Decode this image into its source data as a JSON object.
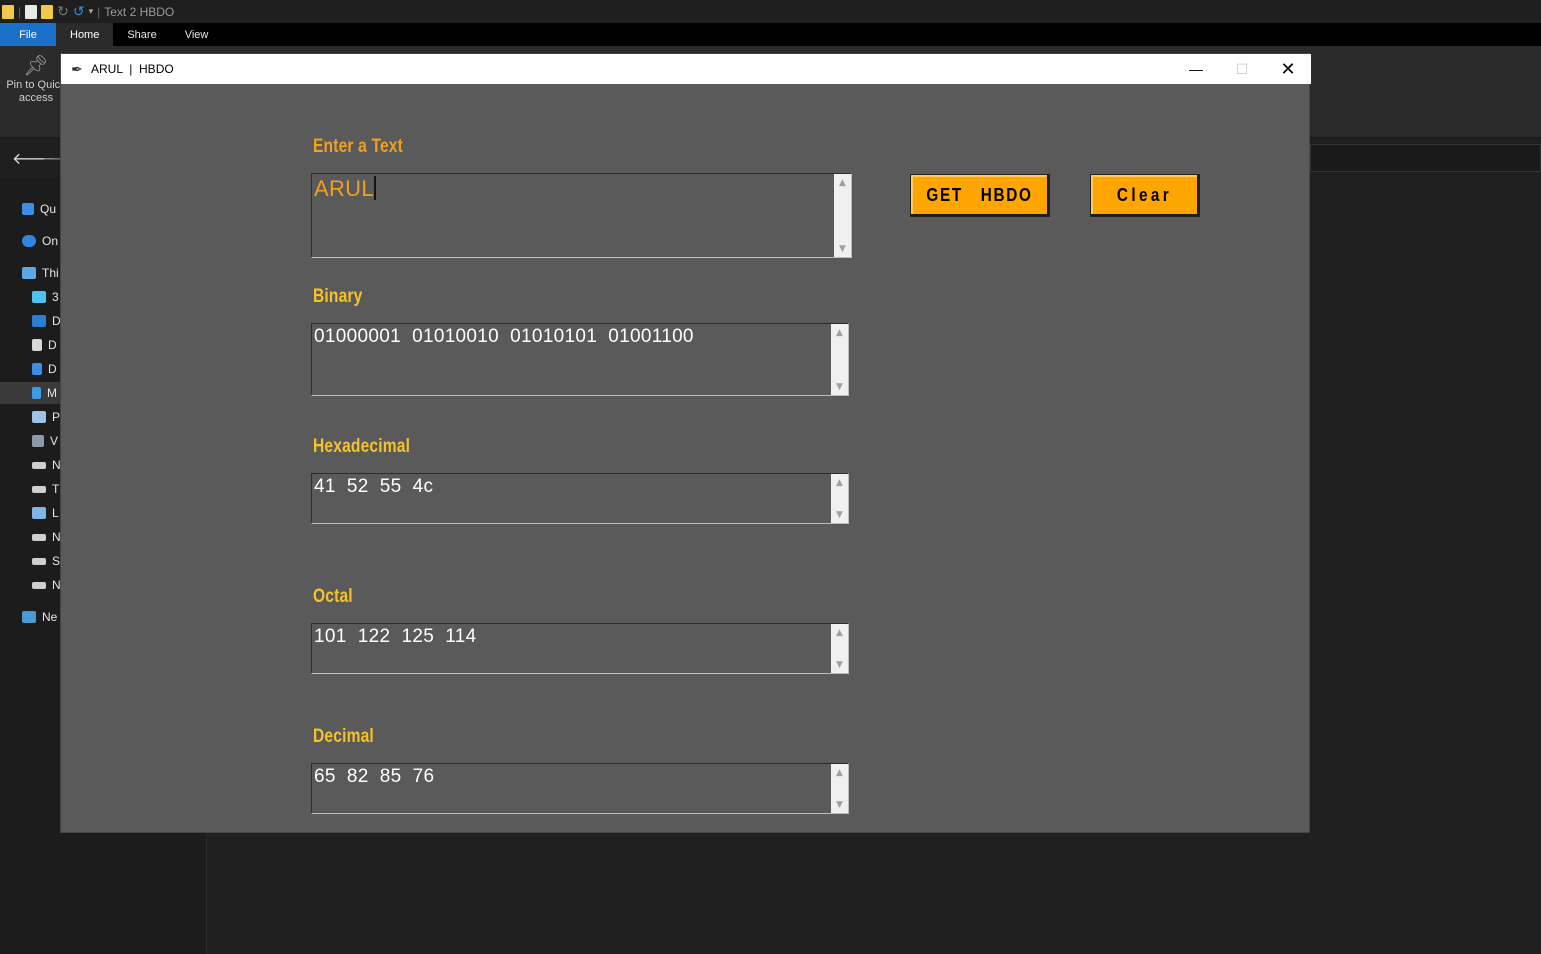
{
  "explorer": {
    "title": "Text 2 HBDO",
    "ribbon_tabs": [
      "File",
      "Home",
      "Share",
      "View"
    ],
    "pin_label": "Pin to Quick access",
    "sidebar": [
      {
        "label": "Qu",
        "icon": "star-icon"
      },
      {
        "label": "On",
        "icon": "cloud-icon"
      },
      {
        "label": "Thi",
        "icon": "computer-icon"
      },
      {
        "label": "3",
        "icon": "cube-icon"
      },
      {
        "label": "D",
        "icon": "desktop-icon"
      },
      {
        "label": "D",
        "icon": "document-icon"
      },
      {
        "label": "D",
        "icon": "download-icon"
      },
      {
        "label": "M",
        "icon": "music-icon"
      },
      {
        "label": "P",
        "icon": "pictures-icon"
      },
      {
        "label": "V",
        "icon": "video-icon"
      },
      {
        "label": "N",
        "icon": "drive-icon"
      },
      {
        "label": "T",
        "icon": "drive-icon"
      },
      {
        "label": "L",
        "icon": "drive-icon"
      },
      {
        "label": "N",
        "icon": "drive-icon"
      },
      {
        "label": "S",
        "icon": "drive-icon"
      },
      {
        "label": "N",
        "icon": "drive-icon"
      },
      {
        "label": "Ne",
        "icon": "network-icon"
      }
    ]
  },
  "app": {
    "title": "ARUL  |  HBDO",
    "input_label": "Enter a Text",
    "input_value": "ARUL",
    "get_button": "GET   HBDO",
    "clear_button": "Clear",
    "binary_label": "Binary",
    "binary_value": "01000001  01010010  01010101  01001100",
    "hex_label": "Hexadecimal",
    "hex_value": "41  52  55  4c",
    "octal_label": "Octal",
    "octal_value": "101  122  125  114",
    "decimal_label": "Decimal",
    "decimal_value": "65  82  85  76"
  },
  "colors": {
    "label": "#f5c22a",
    "input_text": "#f0a020",
    "button": "#ffa500",
    "app_bg": "#5a5a5a"
  }
}
